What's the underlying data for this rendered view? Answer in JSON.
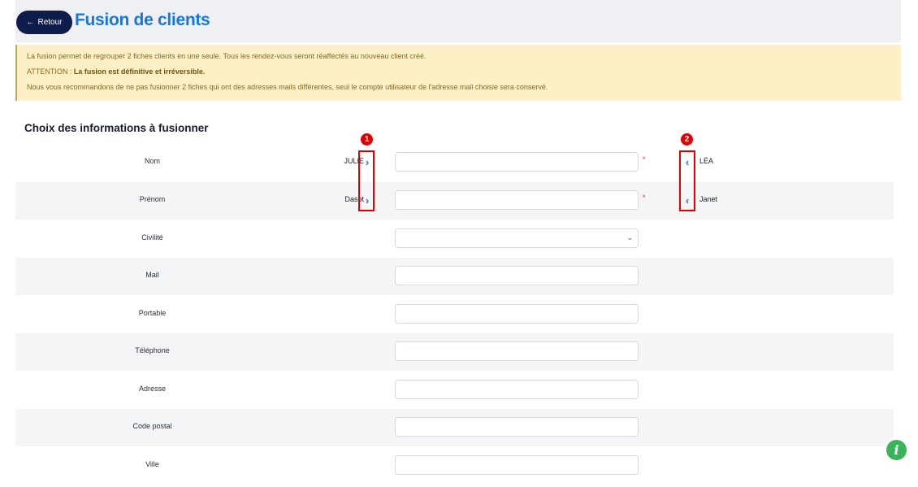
{
  "header": {
    "back_label": "Retour",
    "title": "Fusion de clients"
  },
  "notice": {
    "line1": "La fusion permet de regrouper 2 fiches clients en une seule. Tous les rendez-vous seront réaffectés au nouveau client créé.",
    "line2_prefix": "ATTENTION : ",
    "line2_bold": "La fusion est définitive et irréversible.",
    "line3": "Nous vous recommandons de ne pas fusionner 2 fiches qui ont des adresses mails différentes, seul le compte utilisateur de l'adresse mail choisie sera conservé."
  },
  "form": {
    "title": "Choix des informations à fusionner",
    "required_mark": "*",
    "rows": [
      {
        "label": "Nom",
        "left": "JULIE",
        "right": "LÉA",
        "value": ""
      },
      {
        "label": "Prénom",
        "left": "Dasot",
        "right": "Janet",
        "value": ""
      },
      {
        "label": "Civilité",
        "value": ""
      },
      {
        "label": "Mail",
        "value": ""
      },
      {
        "label": "Portable",
        "value": ""
      },
      {
        "label": "Téléphone",
        "value": ""
      },
      {
        "label": "Adresse",
        "value": ""
      },
      {
        "label": "Code postal",
        "value": ""
      },
      {
        "label": "Ville",
        "value": ""
      }
    ]
  },
  "annotations": {
    "badge1": "1",
    "badge2": "2"
  },
  "icons": {
    "back": "arrow-left-icon",
    "copy_right": "chevron-right-icon",
    "copy_left": "chevron-left-icon",
    "select": "chevron-down-icon",
    "info": "info-icon"
  },
  "colors": {
    "title": "#1677e0",
    "back_button": "#0f1d4d",
    "notice_bg": "#fbf0c6",
    "highlight": "#e00000",
    "info_button": "#38b559"
  }
}
